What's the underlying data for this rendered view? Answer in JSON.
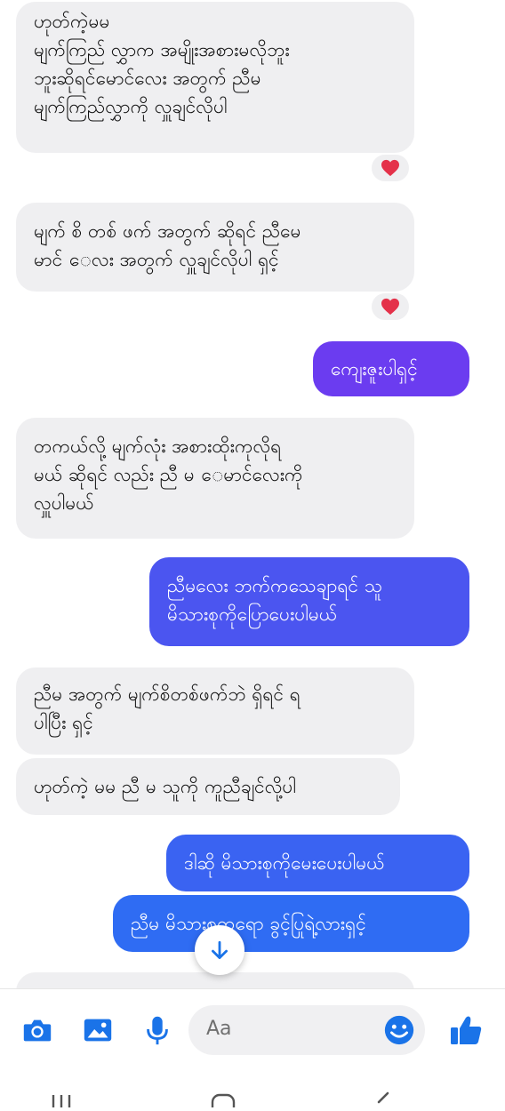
{
  "colors": {
    "incoming_bg": "#efeff1",
    "outgoing_purple": "#6b3cf0",
    "outgoing_blue": "#2f6cf3",
    "accent": "#1a73e8",
    "heart": "#e4314a"
  },
  "messages": [
    {
      "id": 1,
      "from": "incoming",
      "text": "ဟုတ်ကဲ့မမ\nမျက်ကြည် လွှာက အမျိုးအစားမလိုဘူး\nဘူးဆိုရင်မောင်လေး အတွက် ညီမ\nမျက်ကြည်လွှာကို လှူချင်လိုပါ",
      "reaction": "heart-icon"
    },
    {
      "id": 2,
      "from": "incoming",
      "text": "မျက် စိ တစ် ဖက် အတွက် ဆိုရင် ညီမေ\nမာင် ေလး အတွက် လှူချင်လိုပါ ရှင့်",
      "reaction": "heart-icon"
    },
    {
      "id": 3,
      "from": "outgoing",
      "text": "ကျေးဇူးပါရှင့်"
    },
    {
      "id": 4,
      "from": "incoming",
      "text": "တကယ်လို့ မျက်လုံး အစားထိုးကုလိုရ\nမယ် ဆိုရင် လည်း ညီ မ ေမာင်လေးကို\nလှူပါမယ်"
    },
    {
      "id": 5,
      "from": "outgoing",
      "text": "ညီမလေး ဘက်ကသေချာရင် သူ\nမိသားစုကိုပြောပေးပါမယ်"
    },
    {
      "id": 6,
      "from": "incoming",
      "text": "ညီမ အတွက် မျက်စိတစ်ဖက်ဘဲ ရှိရင် ရ\nပါပြီး ရှင့်"
    },
    {
      "id": 7,
      "from": "incoming",
      "text": "ဟုတ်ကဲ့ မမ ညီ မ သူကို ကူညီချင်လို့ပါ"
    },
    {
      "id": 8,
      "from": "outgoing",
      "text": "ဒါဆို မိသားစုကိုမေးပေးပါမယ်"
    },
    {
      "id": 9,
      "from": "outgoing",
      "text": "ညီမ မိသားစုကရော ခွင့်ပြုရဲ့လားရှင့်"
    }
  ],
  "composer": {
    "placeholder": "Aa",
    "icons": [
      "camera-icon",
      "image-icon",
      "microphone-icon",
      "emoji-icon",
      "thumbs-up-icon"
    ]
  },
  "nav_icons": [
    "recent-apps-icon",
    "home-icon",
    "back-icon"
  ]
}
